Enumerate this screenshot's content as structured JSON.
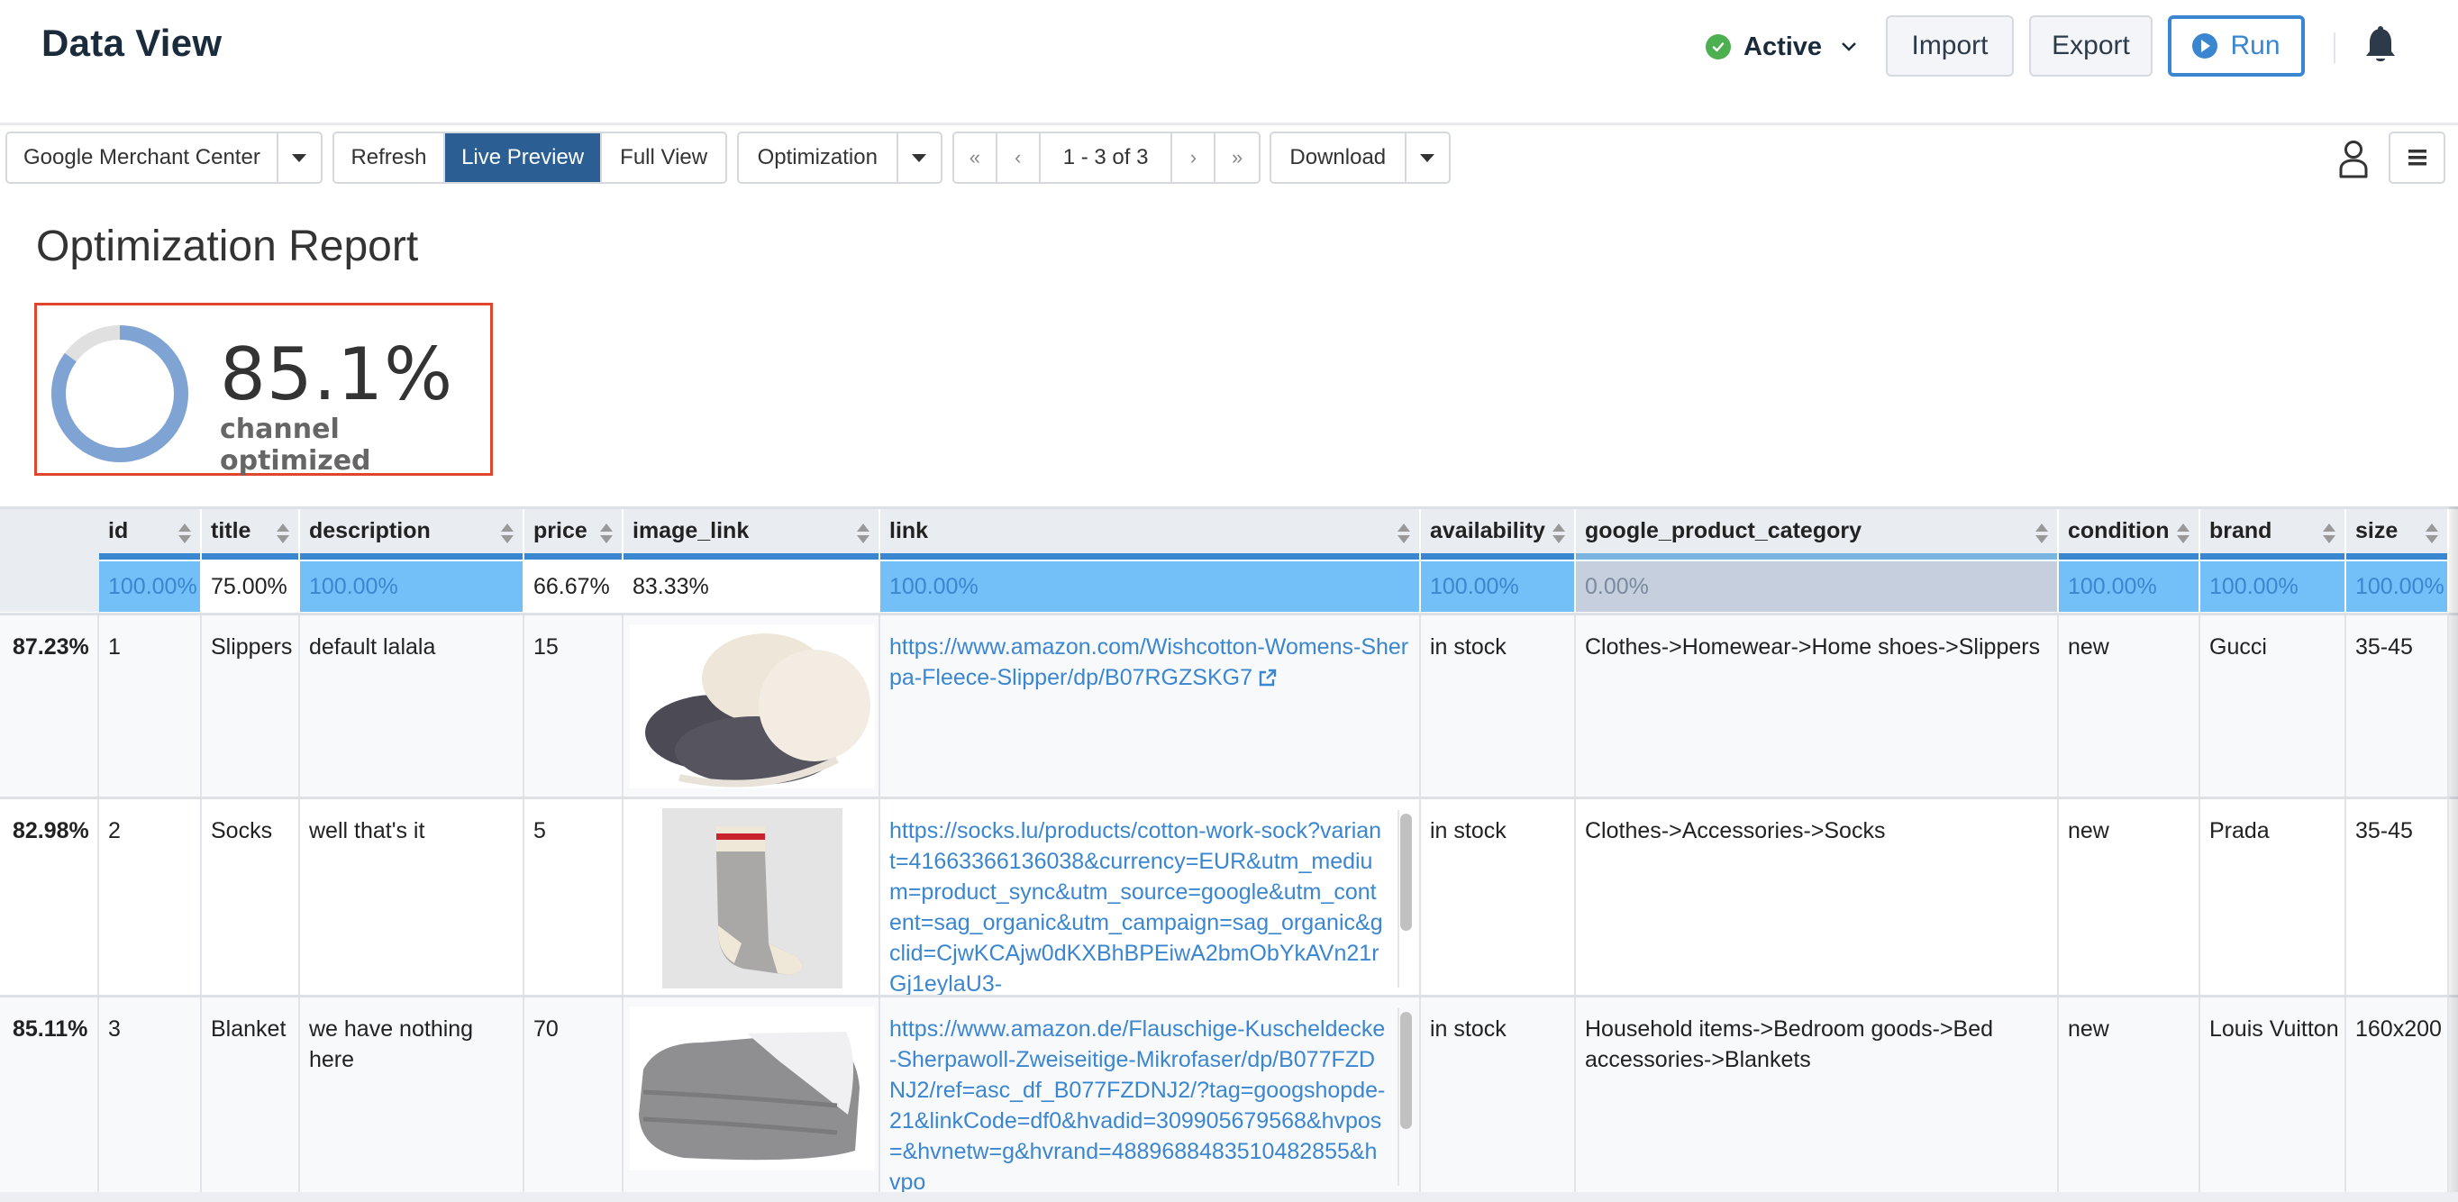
{
  "header": {
    "title": "Data View",
    "status_label": "Active",
    "status_color": "#4caf50",
    "import_label": "Import",
    "export_label": "Export",
    "run_label": "Run",
    "accent_color": "#3b86d0"
  },
  "toolbar": {
    "source_selected": "Google Merchant Center",
    "refresh_label": "Refresh",
    "live_preview_label": "Live Preview",
    "full_view_label": "Full View",
    "active_view": "Live Preview",
    "report_selected": "Optimization",
    "pagination": {
      "first": "«",
      "prev": "‹",
      "range": "1 - 3 of 3",
      "next": "›",
      "last": "»"
    },
    "download_label": "Download"
  },
  "report": {
    "title": "Optimization Report",
    "kpi_value": "85.1%",
    "kpi_fraction": 0.851,
    "kpi_caption": "channel optimized",
    "kpi_fill_color": "#7fa3d3",
    "kpi_rest_color": "#e0e0e0",
    "highlight_border_color": "#e0452e"
  },
  "table": {
    "columns": [
      {
        "key": "id",
        "label": "id",
        "completeness": "100.00%",
        "state": "full"
      },
      {
        "key": "title",
        "label": "title",
        "completeness": "75.00%",
        "state": "plain"
      },
      {
        "key": "description",
        "label": "description",
        "completeness": "100.00%",
        "state": "full"
      },
      {
        "key": "price",
        "label": "price",
        "completeness": "66.67%",
        "state": "plain"
      },
      {
        "key": "image_link",
        "label": "image_link",
        "completeness": "83.33%",
        "state": "plain"
      },
      {
        "key": "link",
        "label": "link",
        "completeness": "100.00%",
        "state": "full"
      },
      {
        "key": "availability",
        "label": "availability",
        "completeness": "100.00%",
        "state": "full"
      },
      {
        "key": "google_product_category",
        "label": "google_product_category",
        "completeness": "0.00%",
        "state": "zero"
      },
      {
        "key": "condition",
        "label": "condition",
        "completeness": "100.00%",
        "state": "full"
      },
      {
        "key": "brand",
        "label": "brand",
        "completeness": "100.00%",
        "state": "full"
      },
      {
        "key": "size",
        "label": "size",
        "completeness": "100.00%",
        "state": "full"
      }
    ],
    "rows": [
      {
        "score": "87.23%",
        "id": "1",
        "title": "Slippers",
        "description": "default lalala",
        "price": "15",
        "image": "slippers-image",
        "link": "https://www.amazon.com/Wishcotton-Womens-Sherpa-Fleece-Slipper/dp/B07RGZSKG7",
        "availability": "in stock",
        "google_product_category": "Clothes->Homewear->Home shoes->Slippers",
        "condition": "new",
        "brand": "Gucci",
        "size": "35-45"
      },
      {
        "score": "82.98%",
        "id": "2",
        "title": "Socks",
        "description": "well that's it",
        "price": "5",
        "image": "socks-image",
        "link": "https://socks.lu/products/cotton-work-sock?variant=41663366136038&currency=EUR&utm_medium=product_sync&utm_source=google&utm_content=sag_organic&utm_campaign=sag_organic&gclid=CjwKCAjw0dKXBhBPEiwA2bmObYkAVn21rGj1eylaU3-",
        "availability": "in stock",
        "google_product_category": "Clothes->Accessories->Socks",
        "condition": "new",
        "brand": "Prada",
        "size": "35-45"
      },
      {
        "score": "85.11%",
        "id": "3",
        "title": "Blanket",
        "description": "we have nothing here",
        "price": "70",
        "image": "blanket-image",
        "link": "https://www.amazon.de/Flauschige-Kuscheldecke-Sherpawoll-Zweiseitige-Mikrofaser/dp/B077FZDNJ2/ref=asc_df_B077FZDNJ2/?tag=googshopde-21&linkCode=df0&hvadid=309905679568&hvpos=&hvnetw=g&hvrand=4889688483510482855&hvpo",
        "availability": "in stock",
        "google_product_category": "Household items->Bedroom goods->Bed accessories->Blankets",
        "condition": "new",
        "brand": "Louis Vuitton",
        "size": "160x200"
      }
    ]
  }
}
